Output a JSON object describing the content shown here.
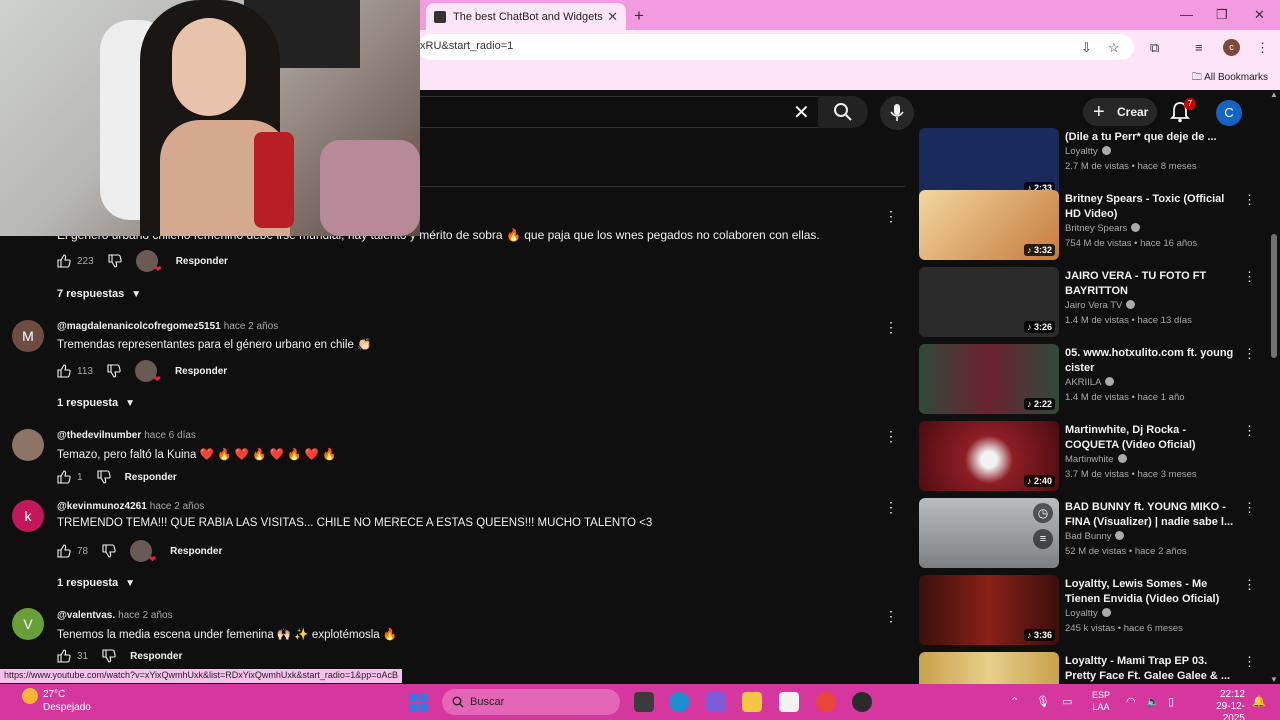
{
  "browser": {
    "tab_title": "The best ChatBot and Widgets",
    "url_fragment": "xRU&start_radio=1",
    "all_bookmarks": "All Bookmarks",
    "profile_letter": "c",
    "status_url": "https://www.youtube.com/watch?v=xYixQwmhUxk&list=RDxYixQwmhUxk&start_radio=1&pp=oAcB"
  },
  "youtube": {
    "create_label": "Crear",
    "notif_count": "7",
    "user_letter": "C",
    "cutoff_comment": "El género urbano chileno femenino debe irse mundial, hay talento y mérito de sobra 🔥 que paja que los wnes pegados no colaboren con ellas."
  },
  "comments": [
    {
      "likes": "223",
      "reply_label": "Responder",
      "replies": "7 respuestas"
    },
    {
      "avatar": "M",
      "avatar_color": "#6d4c41",
      "author": "@magdalenanicolcofregomez5151",
      "time": "hace 2 años",
      "text": "Tremendas representantes para el género urbano en chile 👏🏻",
      "likes": "113",
      "reply_label": "Responder",
      "replies": "1 respuesta"
    },
    {
      "avatar": "",
      "avatar_color": "#8d7467",
      "author": "@thedevilnumber",
      "time": "hace 6 días",
      "text": "Temazo, pero faltó la Kuina ❤️ 🔥 ❤️ 🔥 ❤️ 🔥 ❤️ 🔥",
      "likes": "1",
      "reply_label": "Responder"
    },
    {
      "avatar": "k",
      "avatar_color": "#c2185b",
      "author": "@kevinmunoz4261",
      "time": "hace 2 años",
      "text": "TREMENDO TEMA!!! QUE RABIA LAS VISITAS... CHILE NO MERECE A ESTAS QUEENS!!! MUCHO TALENTO <3",
      "likes": "78",
      "reply_label": "Responder",
      "replies": "1 respuesta"
    },
    {
      "avatar": "V",
      "avatar_color": "#689f38",
      "author": "@valentvas.",
      "time": "hace 2 años",
      "text": "Tenemos la media escena under femenina 🙌🏻 ✨ explotémosla 🔥",
      "likes": "31",
      "reply_label": "Responder"
    }
  ],
  "videos": [
    {
      "title": "(Dile a tu Perr* que deje de ...",
      "channel": "Loyaltty",
      "meta": "2.7 M de vistas • hace 8 meses",
      "duration": "♪ 2:33",
      "thumb": "#1b2a5c"
    },
    {
      "title": "Britney Spears - Toxic (Official HD Video)",
      "channel": "Britney Spears",
      "meta": "754 M de vistas • hace 16 años",
      "duration": "♪ 3:32",
      "thumb": "#e0b070"
    },
    {
      "title": "JAIRO VERA - TU FOTO FT BAYRITTON",
      "channel": "Jairo Vera TV",
      "meta": "1.4 M de vistas • hace 13 días",
      "duration": "♪ 3:26",
      "thumb": "#2b2b2b"
    },
    {
      "title": "05. www.hotxulito.com ft. young cister",
      "channel": "AKRIILA",
      "meta": "1.4 M de vistas • hace 1 año",
      "duration": "♪ 2:22",
      "thumb": "#2f4a3a"
    },
    {
      "title": "Martinwhite, Dj Rocka - COQUETA (Video Oficial)",
      "channel": "Martinwhite",
      "meta": "3.7 M de vistas • hace 3 meses",
      "duration": "♪ 2:40",
      "thumb": "#8e1d25"
    },
    {
      "title": "BAD BUNNY ft. YOUNG MIKO - FINA (Visualizer) | nadie sabe l...",
      "channel": "Bad Bunny",
      "meta": "52 M de vistas • hace 2 años",
      "duration": "",
      "thumb": "#8a8f93"
    },
    {
      "title": "Loyaltty, Lewis Somes - Me Tienen Envidia (Video Oficial)",
      "channel": "Loyaltty",
      "meta": "245 k vistas • hace 6 meses",
      "duration": "♪ 3:36",
      "thumb": "#5a1512"
    },
    {
      "title": "Loyaltty - Mami Trap EP 03. Pretty Face Ft. Galee Galee & ...",
      "channel": "",
      "meta": "",
      "duration": "",
      "thumb": "#c9a24c"
    }
  ],
  "taskbar": {
    "temp": "27°C",
    "weather": "Despejado",
    "search_label": "Buscar",
    "lang_line1": "ESP",
    "lang_line2": "LAA",
    "time": "22:12",
    "date": "29-12-2025"
  }
}
